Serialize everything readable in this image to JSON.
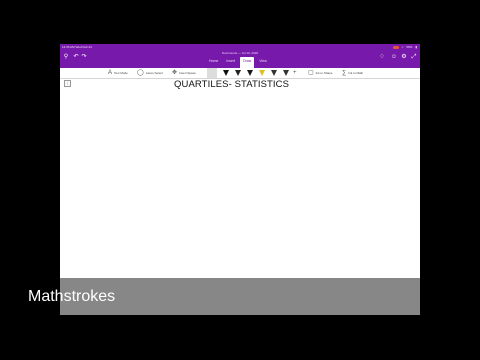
{
  "statusbar": {
    "time": "12:35 AM",
    "date": "Wed Feb 24",
    "battery": "56%"
  },
  "titlebar": {
    "doc_title": "Documents — Jul 10, 2020",
    "tabs": [
      {
        "label": "Home"
      },
      {
        "label": "Insert"
      },
      {
        "label": "Draw",
        "active": true
      },
      {
        "label": "View"
      }
    ]
  },
  "ribbon": {
    "text_mode": "Text Mode",
    "lasso_select": "Lasso Select",
    "insert_space": "Insert Space",
    "ink_to_shape": "Ink to Shape",
    "ink_to_math": "Ink to Math"
  },
  "page": {
    "heading": "QUARTILES- STATISTICS"
  },
  "overlay": {
    "caption": "Mathstrokes"
  },
  "colors": {
    "accent": "#7719aa",
    "caption_band": "#878787",
    "background": "#000000"
  }
}
